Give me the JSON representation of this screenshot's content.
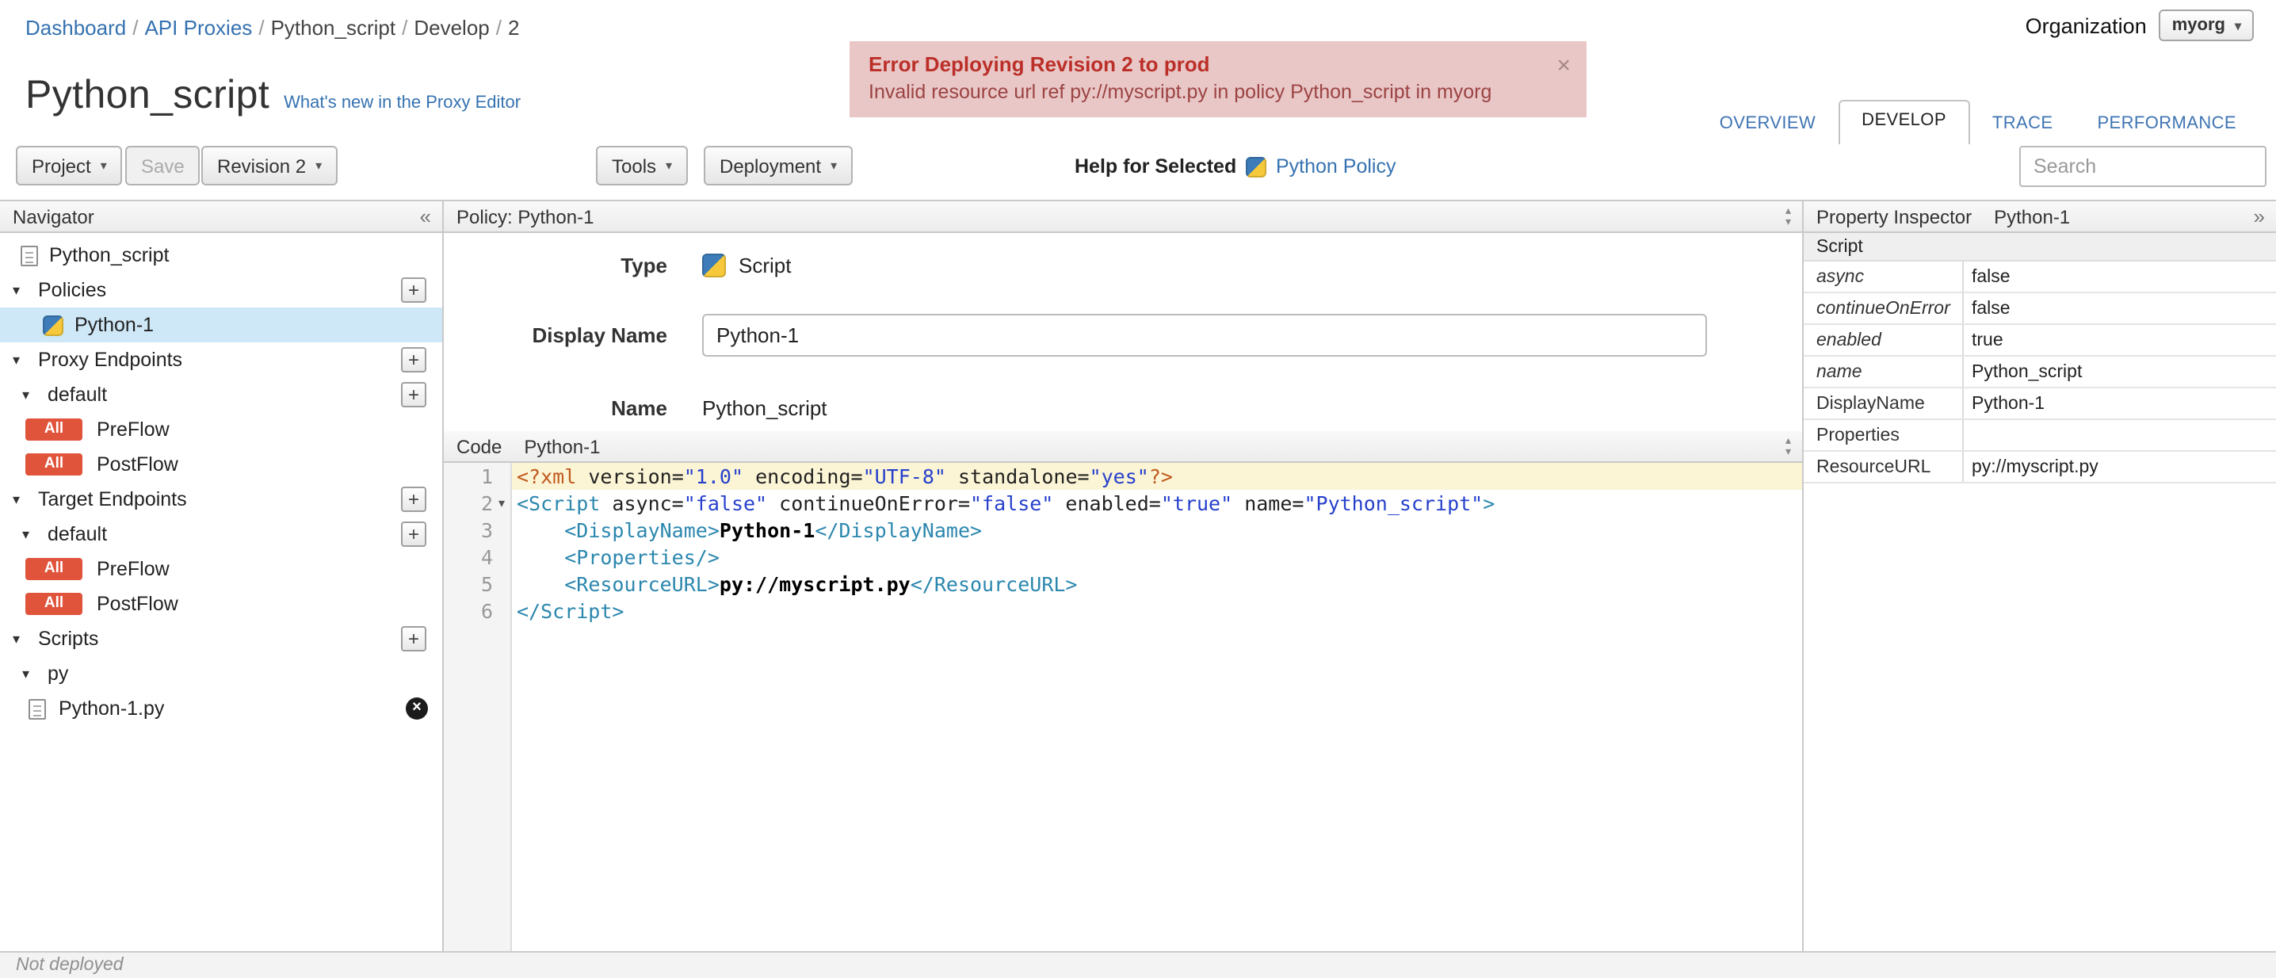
{
  "icons": {
    "caret": "▾",
    "plus": "+",
    "close": "×",
    "delete": "×",
    "collapse_left": "«",
    "collapse_right": "»",
    "chevron_up": "▴",
    "chevron_down": "▾"
  },
  "breadcrumb": {
    "items": [
      "Dashboard",
      "API Proxies",
      "Python_script",
      "Develop",
      "2"
    ],
    "separator": "/"
  },
  "organization": {
    "label": "Organization",
    "value": "myorg"
  },
  "error_banner": {
    "title": "Error Deploying Revision 2 to prod",
    "message": "Invalid resource url ref py://myscript.py in policy Python_script in myorg",
    "close": "×"
  },
  "header": {
    "title": "Python_script",
    "whats_new_link": "What's new in the Proxy Editor"
  },
  "tabs": [
    {
      "label": "OVERVIEW",
      "active": false
    },
    {
      "label": "DEVELOP",
      "active": true
    },
    {
      "label": "TRACE",
      "active": false
    },
    {
      "label": "PERFORMANCE",
      "active": false
    }
  ],
  "toolbar": {
    "project_label": "Project",
    "save_label": "Save",
    "revision_label": "Revision 2",
    "tools_label": "Tools",
    "deployment_label": "Deployment",
    "help_for_selected_label": "Help for Selected",
    "policy_help_link": "Python Policy",
    "search_placeholder": "Search"
  },
  "navigator": {
    "title": "Navigator",
    "root_label": "Python_script",
    "policies": {
      "label": "Policies",
      "items": [
        {
          "label": "Python-1",
          "selected": true
        }
      ]
    },
    "proxy_endpoints": {
      "label": "Proxy Endpoints",
      "groups": [
        {
          "label": "default",
          "flows": [
            {
              "badge": "All",
              "label": "PreFlow"
            },
            {
              "badge": "All",
              "label": "PostFlow"
            }
          ]
        }
      ]
    },
    "target_endpoints": {
      "label": "Target Endpoints",
      "groups": [
        {
          "label": "default",
          "flows": [
            {
              "badge": "All",
              "label": "PreFlow"
            },
            {
              "badge": "All",
              "label": "PostFlow"
            }
          ]
        }
      ]
    },
    "scripts": {
      "label": "Scripts",
      "groups": [
        {
          "label": "py",
          "files": [
            {
              "label": "Python-1.py"
            }
          ]
        }
      ]
    }
  },
  "policy_panel": {
    "header": "Policy: Python-1",
    "type_label": "Type",
    "type_value": "Script",
    "display_name_label": "Display Name",
    "display_name_value": "Python-1",
    "name_label": "Name",
    "name_value": "Python_script"
  },
  "code_panel": {
    "label": "Code",
    "context": "Python-1",
    "lines": [
      {
        "no": "1",
        "active": true,
        "fold": false,
        "tokens": [
          [
            "meta",
            "<?xml"
          ],
          [
            "plain",
            " version="
          ],
          [
            "str",
            "\"1.0\""
          ],
          [
            "plain",
            " encoding="
          ],
          [
            "str",
            "\"UTF-8\""
          ],
          [
            "plain",
            " standalone="
          ],
          [
            "str",
            "\"yes\""
          ],
          [
            "meta",
            "?>"
          ]
        ]
      },
      {
        "no": "2",
        "active": false,
        "fold": true,
        "tokens": [
          [
            "tag",
            "<Script"
          ],
          [
            "plain",
            " async="
          ],
          [
            "str",
            "\"false\""
          ],
          [
            "plain",
            " continueOnError="
          ],
          [
            "str",
            "\"false\""
          ],
          [
            "plain",
            " enabled="
          ],
          [
            "str",
            "\"true\""
          ],
          [
            "plain",
            " name="
          ],
          [
            "str",
            "\"Python_script\""
          ],
          [
            "tag",
            ">"
          ]
        ]
      },
      {
        "no": "3",
        "active": false,
        "fold": false,
        "tokens": [
          [
            "plain",
            "    "
          ],
          [
            "tag",
            "<DisplayName>"
          ],
          [
            "text",
            "Python-1"
          ],
          [
            "tag",
            "</DisplayName>"
          ]
        ]
      },
      {
        "no": "4",
        "active": false,
        "fold": false,
        "tokens": [
          [
            "plain",
            "    "
          ],
          [
            "tag",
            "<Properties/>"
          ]
        ]
      },
      {
        "no": "5",
        "active": false,
        "fold": false,
        "tokens": [
          [
            "plain",
            "    "
          ],
          [
            "tag",
            "<ResourceURL>"
          ],
          [
            "text",
            "py://myscript.py"
          ],
          [
            "tag",
            "</ResourceURL>"
          ]
        ]
      },
      {
        "no": "6",
        "active": false,
        "fold": false,
        "tokens": [
          [
            "tag",
            "</Script>"
          ]
        ]
      }
    ]
  },
  "inspector": {
    "title": "Property Inspector",
    "context": "Python-1",
    "section": "Script",
    "rows": [
      {
        "label": "async",
        "value": "false"
      },
      {
        "label": "continueOnError",
        "value": "false"
      },
      {
        "label": "enabled",
        "value": "true"
      },
      {
        "label": "name",
        "value": "Python_script"
      },
      {
        "label": "DisplayName",
        "value": "Python-1"
      },
      {
        "label": "Properties",
        "value": ""
      },
      {
        "label": "ResourceURL",
        "value": "py://myscript.py"
      }
    ]
  },
  "status_bar": {
    "text": "Not deployed"
  }
}
